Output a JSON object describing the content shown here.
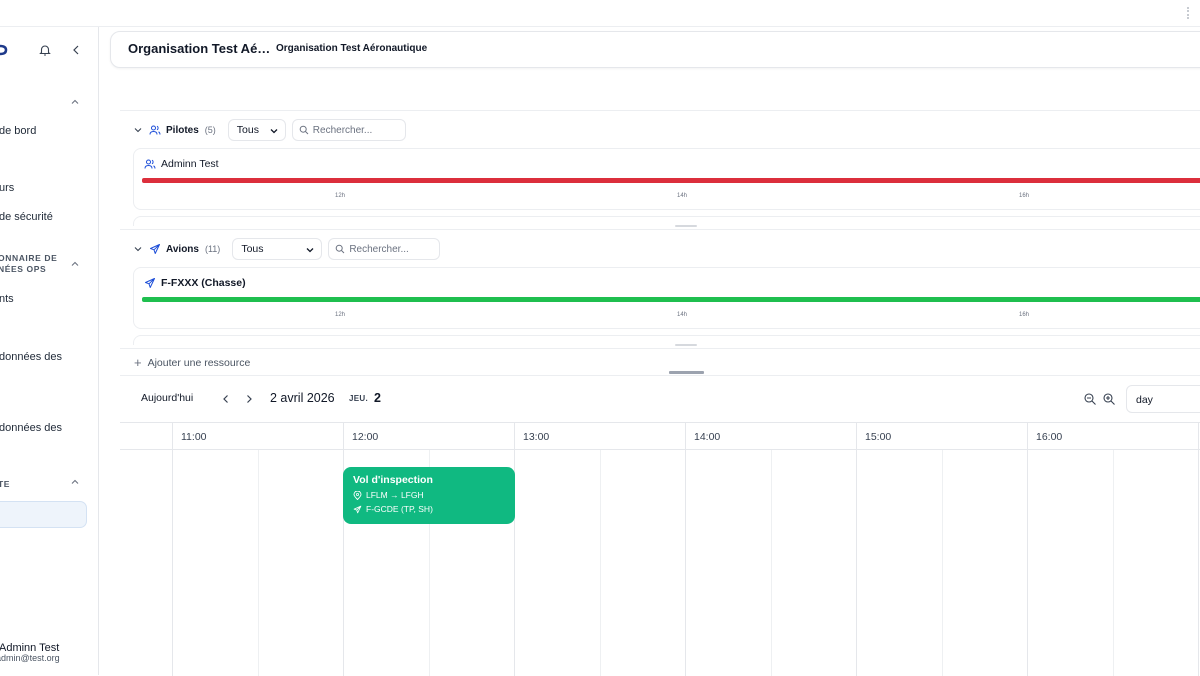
{
  "header": {
    "title": "Organisation Test Aé…",
    "subtitle": "Organisation Test Aéronautique"
  },
  "sidebar": {
    "items": [
      "de bord",
      "urs",
      "de sécurité",
      "nts",
      "données des",
      "données des"
    ],
    "sections": [
      "ONNAIRE DE",
      "NÉES OPS",
      "TE"
    ],
    "user_name": "Adminn Test",
    "user_email": "admin@test.org"
  },
  "pilots": {
    "label": "Pilotes",
    "count": "(5)",
    "filter": "Tous",
    "search_placeholder": "Rechercher...",
    "resource_name": "Adminn Test",
    "bar_color": "#dc2f3c",
    "ticks": [
      "12h",
      "14h",
      "16h"
    ]
  },
  "aircraft": {
    "label": "Avions",
    "count": "(11)",
    "filter": "Tous",
    "search_placeholder": "Rechercher...",
    "resource_name": "F-FXXX (Chasse)",
    "bar_color": "#1fbf4f",
    "ticks": [
      "12h",
      "14h",
      "16h"
    ]
  },
  "add_resource": "Ajouter une ressource",
  "calendar": {
    "today_label": "Aujourd'hui",
    "date": "2 avril 2026",
    "day_of_week": "JEU.",
    "day_number": "2",
    "view": "day",
    "hours": [
      "11:00",
      "12:00",
      "13:00",
      "14:00",
      "15:00",
      "16:00"
    ]
  },
  "event": {
    "title": "Vol d'inspection",
    "route": "LFLM → LFGH",
    "aircraft": "F-GCDE (TP, SH)",
    "color": "#10b981"
  }
}
